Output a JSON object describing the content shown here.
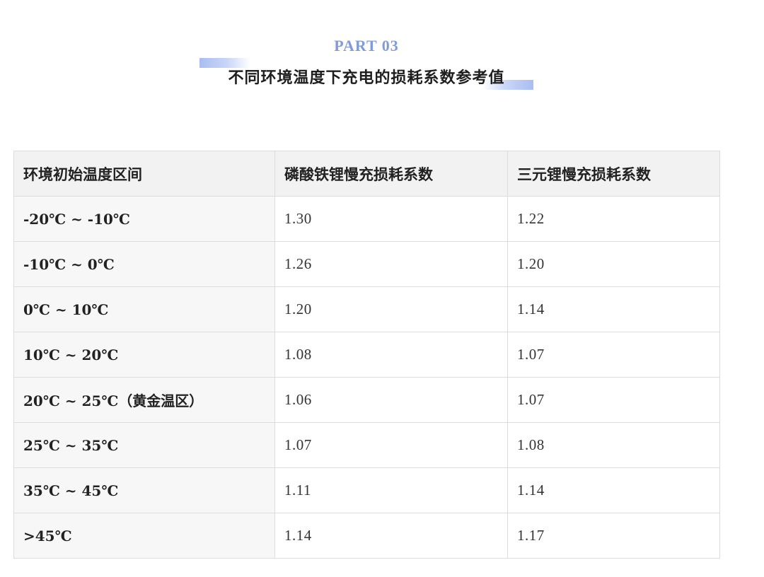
{
  "header": {
    "part_label": "PART 03",
    "title": "不同环境温度下充电的损耗系数参考值"
  },
  "table": {
    "columns": [
      "环境初始温度区间",
      "磷酸铁锂慢充损耗系数",
      "三元锂慢充损耗系数"
    ],
    "rows": [
      {
        "range": "-20℃ ~ -10℃",
        "lfp": "1.30",
        "ncm": "1.22"
      },
      {
        "range": "-10℃ ~ 0℃",
        "lfp": "1.26",
        "ncm": "1.20"
      },
      {
        "range": "0℃ ~ 10℃",
        "lfp": "1.20",
        "ncm": "1.14"
      },
      {
        "range": "10℃ ~ 20℃",
        "lfp": "1.08",
        "ncm": "1.07"
      },
      {
        "range": "20℃ ~ 25℃（黄金温区）",
        "lfp": "1.06",
        "ncm": "1.07"
      },
      {
        "range": "25℃ ~ 35℃",
        "lfp": "1.07",
        "ncm": "1.08"
      },
      {
        "range": "35℃ ~ 45℃",
        "lfp": "1.11",
        "ncm": "1.14"
      },
      {
        "range": ">45℃",
        "lfp": "1.14",
        "ncm": "1.17"
      }
    ]
  },
  "colors": {
    "accent": "#7f9bdc",
    "header_bg": "#f2f2f2",
    "border": "#dcdcdc"
  }
}
